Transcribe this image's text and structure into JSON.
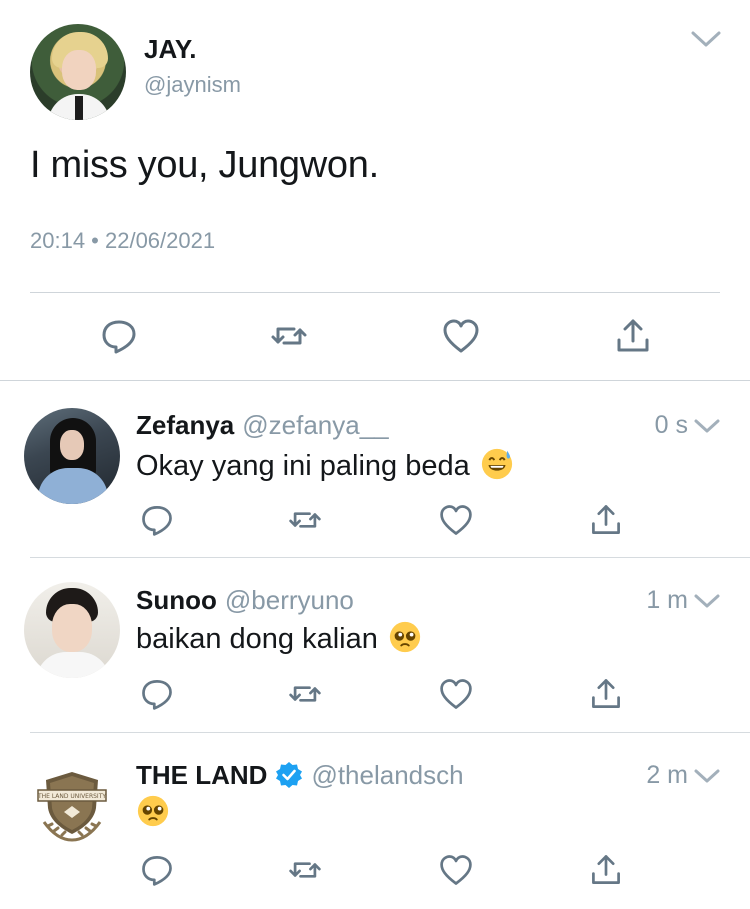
{
  "main_tweet": {
    "author_name": "JAY.",
    "author_handle": "@jaynism",
    "text": "I miss you, Jungwon.",
    "timestamp": "20:14 • 22/06/2021",
    "actions": [
      "reply-icon",
      "retweet-icon",
      "like-icon",
      "share-icon"
    ]
  },
  "replies": [
    {
      "name": "Zefanya",
      "handle": "@zefanya__",
      "time": "0 s",
      "text": "Okay yang ini paling beda",
      "emoji": "grinning-sweat-emoji",
      "verified": false
    },
    {
      "name": "Sunoo",
      "handle": "@berryuno",
      "time": "1 m",
      "text": "baikan dong kalian",
      "emoji": "pleading-face-emoji",
      "verified": false
    },
    {
      "name": "THE LAND",
      "handle": "@thelandsch",
      "time": "2 m",
      "text": "",
      "emoji": "pleading-face-emoji",
      "verified": true
    }
  ],
  "logo_text": "THE LAND UNIVERSITY",
  "colors": {
    "primary_text": "#14171a",
    "secondary_text": "#8899a6",
    "icon_gray": "#657786",
    "verified_blue": "#1da1f2",
    "divider": "#cfd5da"
  }
}
